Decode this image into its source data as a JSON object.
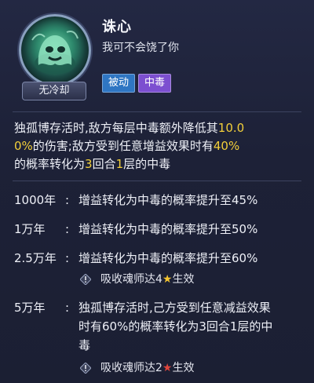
{
  "skill": {
    "name": "诛心",
    "quote": "我可不会饶了你",
    "cooldown_badge": "无冷却",
    "icon": "green-ghost-skill-icon",
    "tags": [
      "被动",
      "中毒"
    ]
  },
  "description": {
    "p1": "独孤博存活时,敌方每层中毒额外降低其",
    "v1": "10.0",
    "v1b": "0%",
    "p2": "的伤害;敌方受到任意增益效果时有",
    "v2": "40%",
    "p3": "的概率转化为",
    "v3": "3",
    "p4": "回合",
    "v4": "1",
    "p5": "层的中毒"
  },
  "upgrades": [
    {
      "year": "1000年",
      "colon": ":",
      "text": "增益转化为中毒的概率提升至45%"
    },
    {
      "year": "1万年",
      "colon": ":",
      "text": "增益转化为中毒的概率提升至50%"
    },
    {
      "year": "2.5万年",
      "colon": ":",
      "text": "增益转化为中毒的概率提升至60%",
      "condition": {
        "pre": "吸收魂师达4",
        "star": "★",
        "post": "生效"
      }
    },
    {
      "year": "5万年",
      "colon": ":",
      "text": "独孤博存活时,己方受到任意减益效果时有60%的概率转化为3回合1层的中毒",
      "condition": {
        "pre": "吸收魂师达2",
        "star": "★",
        "post": "生效"
      }
    }
  ],
  "colors": {
    "highlight": "#f2cf3a",
    "tag_passive": "#2f76c3",
    "tag_poison": "#7c4fd0",
    "star_gold": "#f4c430",
    "star_red": "#e0453c"
  }
}
